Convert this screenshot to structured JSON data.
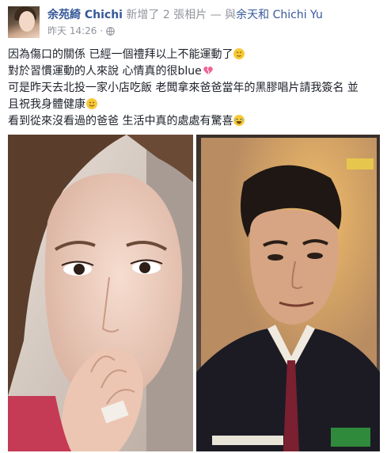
{
  "post": {
    "author_name": "余苑綺 Chichi",
    "action_text": " 新增了 2 張相片 — 與",
    "tagged_name": "余天和 Chichi Yu",
    "timestamp": "昨天 14:26",
    "separator": "·",
    "privacy_icon": "globe-icon",
    "lines": [
      {
        "text": "因為傷口的關係 已經一個禮拜以上不能運動了",
        "emoji": "relieved-face-emoji"
      },
      {
        "text": "對於習慣運動的人來說 心情真的很blue",
        "emoji": "broken-heart-emoji"
      },
      {
        "text": "可是昨天去北投一家小店吃飯 老闆拿來爸爸當年的黑膠唱片請我簽名 並",
        "emoji": ""
      },
      {
        "text": "且祝我身體健康",
        "emoji": "smiling-face-emoji"
      },
      {
        "text": "看到從來沒看過的爸爸 生活中真的處處有驚喜",
        "emoji": "laughing-face-emoji"
      }
    ],
    "photos": [
      {
        "description_name": "selfie-photo"
      },
      {
        "description_name": "album-cover-photo"
      }
    ]
  },
  "colors": {
    "link": "#365899",
    "meta": "#90949c",
    "text": "#1d2129",
    "emoji_yellow": "#f7c938",
    "heart_pink": "#f06292"
  }
}
